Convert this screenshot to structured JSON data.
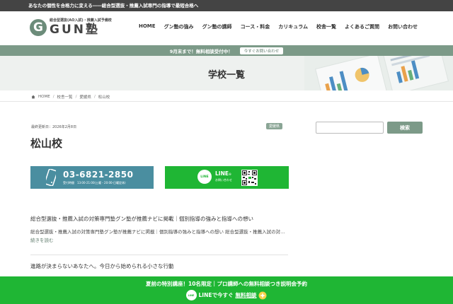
{
  "topbar": {
    "text": "あなたの個性を合格力に変える――総合型選抜・推薦入試専門の指導で最短合格へ"
  },
  "header": {
    "logo_letter": "G",
    "logo_sub": "総合型選抜(AO入試)・推薦入試予備校",
    "logo_main": "GUN塾",
    "nav": [
      "HOME",
      "グン塾の強み",
      "グン塾の講師",
      "コース・料金",
      "カリキュラム",
      "校舎一覧",
      "よくあるご質問",
      "お問い合わせ"
    ]
  },
  "notice": {
    "text": "9月末まで！無料相談受付中！",
    "button": "今すぐお問い合わせ"
  },
  "hero": {
    "title": "学校一覧"
  },
  "breadcrumb": {
    "home": "HOME",
    "items": [
      "校舎一覧",
      "愛媛県",
      "松山校"
    ]
  },
  "post": {
    "updated": "最終更新日：2026年2月8日",
    "prefecture": "愛媛県",
    "title": "松山校"
  },
  "contact": {
    "tel": "03-6821-2850",
    "hours": "受付時間　13:00-21:00(土曜・20:00-日曜定休)",
    "line_label": "LINE",
    "line_icon_text": "LINE",
    "line_suffix": "®",
    "line_sub": "お問い合わせ"
  },
  "entries": [
    {
      "title": "総合型選抜・推薦入試の対策専門塾グン塾が推薦ナビに掲載｜個別指導の強みと指導への想い",
      "excerpt": "総合型選抜・推薦入試の対策専門塾グン塾が推薦ナビに掲載｜個別指導の強みと指導への想い 総合型選抜・推薦入試の対…",
      "readmore": "続きを読む"
    },
    {
      "title": "進路が決まらないあなたへ。今日から始められる小さな行動"
    }
  ],
  "sidebar": {
    "search_placeholder": "",
    "search_button": "検索"
  },
  "banner": {
    "line1": "夏前の特別講座！10名限定｜プロ講師への無料相談つき説明会予約",
    "line_icon_text": "LINE",
    "line2_prefix": "LINEで今すぐ",
    "line2_emph": "無料相談"
  },
  "colors": {
    "accent": "#7c9a88",
    "line_green": "#1fb634",
    "tel_blue": "#4a8ea0"
  }
}
